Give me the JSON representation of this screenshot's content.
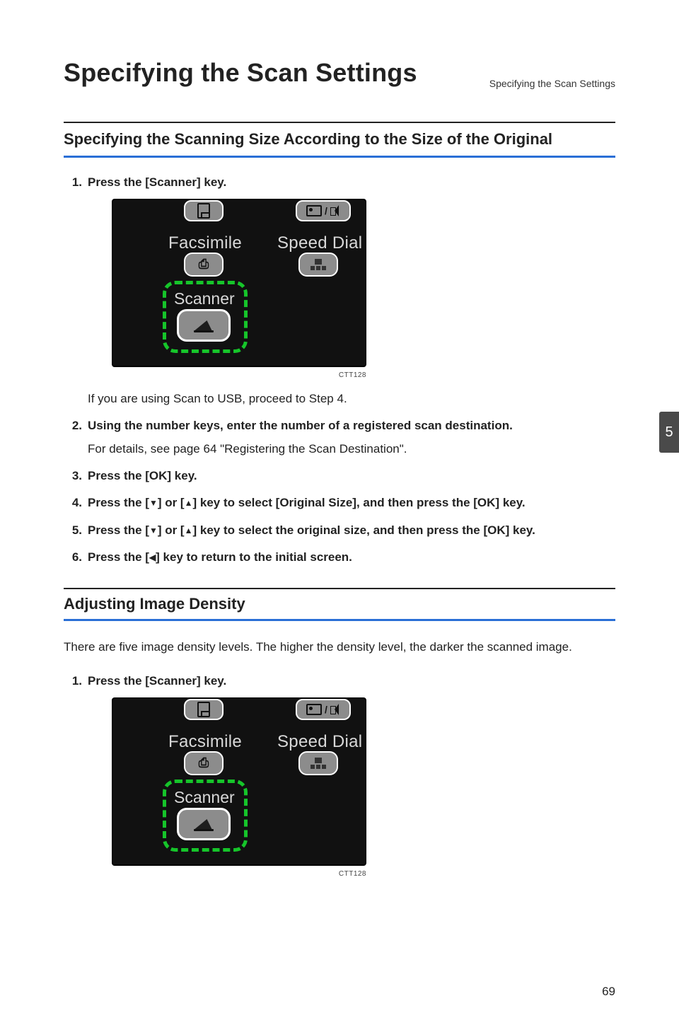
{
  "running_head": "Specifying the Scan Settings",
  "h1": "Specifying the Scan Settings",
  "section1": {
    "title": "Specifying the Scanning Size According to the Size of the Original",
    "steps": [
      {
        "num": "1.",
        "bold": "Press the [Scanner] key."
      },
      {
        "num": "2.",
        "bold": "Using the number keys, enter the number of a registered scan destination.",
        "plain": "For details, see page 64 \"Registering the Scan Destination\"."
      },
      {
        "num": "3.",
        "bold": "Press the [OK] key."
      },
      {
        "num": "4.",
        "bold_pre": "Press the [",
        "arrow1": "▼",
        "bold_mid1": "] or [",
        "arrow2": "▲",
        "bold_post": "] key to select [Original Size], and then press the [OK] key."
      },
      {
        "num": "5.",
        "bold_pre": "Press the [",
        "arrow1": "▼",
        "bold_mid1": "] or [",
        "arrow2": "▲",
        "bold_post": "] key to select the original size, and then press the [OK] key."
      },
      {
        "num": "6.",
        "bold_pre": "Press the [",
        "arrow1": "◀",
        "bold_post2": "] key to return to the initial screen."
      }
    ],
    "sub_note": "If you are using Scan to USB, proceed to Step 4."
  },
  "panel": {
    "facsimile": "Facsimile",
    "speed_dial": "Speed Dial",
    "scanner": "Scanner",
    "caption": "CTT128"
  },
  "section2": {
    "title": "Adjusting Image Density",
    "intro": "There are five image density levels. The higher the density level, the darker the scanned image.",
    "step1_num": "1.",
    "step1_bold": "Press the [Scanner] key."
  },
  "side_tab": "5",
  "page_number": "69"
}
